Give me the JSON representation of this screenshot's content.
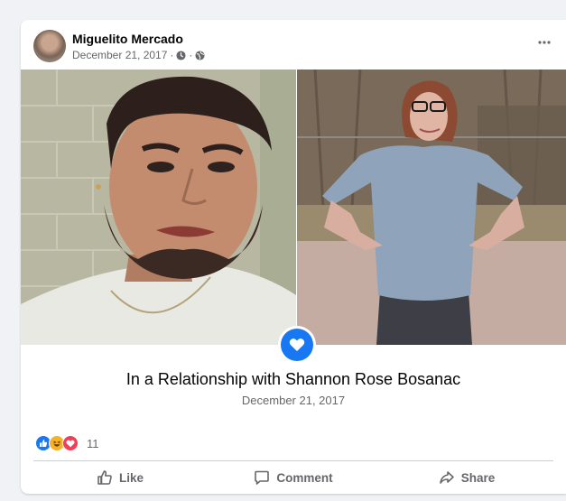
{
  "post": {
    "author": "Miguelito Mercado",
    "date": "December 21, 2017",
    "separator": "·",
    "life_event": {
      "title": "In a Relationship with Shannon Rose Bosanac",
      "date": "December 21, 2017"
    },
    "reactions": {
      "types": [
        "like-icon",
        "haha-icon",
        "love-icon"
      ],
      "count": "11"
    },
    "actions": {
      "like": "Like",
      "comment": "Comment",
      "share": "Share"
    }
  },
  "colors": {
    "accent": "#1877f2",
    "text": "#050505",
    "secondary_text": "#65676b",
    "background": "#f0f2f5",
    "love": "#f33e58",
    "haha": "#f7b125"
  }
}
